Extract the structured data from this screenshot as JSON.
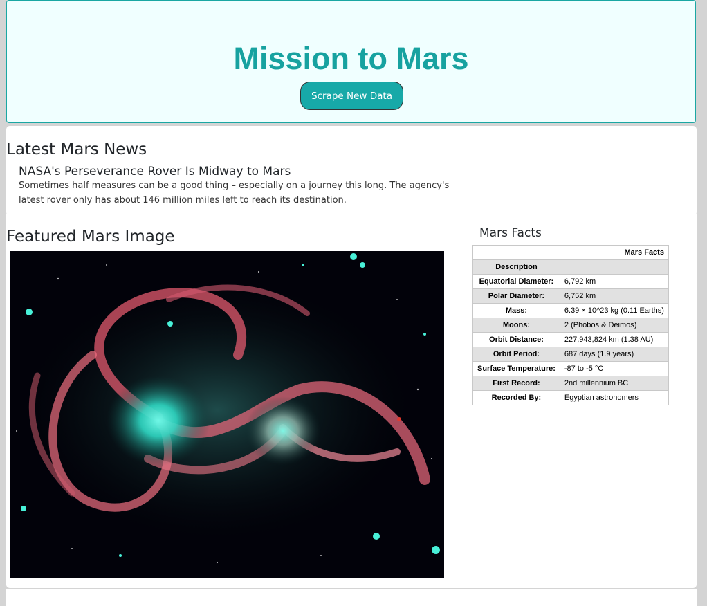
{
  "header": {
    "title": "Mission to Mars",
    "scrape_label": "Scrape New Data"
  },
  "news": {
    "heading": "Latest Mars News",
    "title": "NASA's Perseverance Rover Is Midway to Mars",
    "teaser": "Sometimes half measures can be a good thing – especially on a journey this long. The agency's latest rover only has about 146 million miles left to reach its destination."
  },
  "featured": {
    "heading": "Featured Mars Image"
  },
  "facts": {
    "heading": "Mars Facts",
    "header_row": {
      "label": "",
      "value": "Mars Facts"
    },
    "rows": [
      {
        "label": "Description",
        "value": ""
      },
      {
        "label": "Equatorial Diameter:",
        "value": "6,792 km"
      },
      {
        "label": "Polar Diameter:",
        "value": "6,752 km"
      },
      {
        "label": "Mass:",
        "value": "6.39 × 10^23 kg (0.11 Earths)"
      },
      {
        "label": "Moons:",
        "value": "2 (Phobos & Deimos)"
      },
      {
        "label": "Orbit Distance:",
        "value": "227,943,824 km (1.38 AU)"
      },
      {
        "label": "Orbit Period:",
        "value": "687 days (1.9 years)"
      },
      {
        "label": "Surface Temperature:",
        "value": "-87 to -5 °C"
      },
      {
        "label": "First Record:",
        "value": "2nd millennium BC"
      },
      {
        "label": "Recorded By:",
        "value": "Egyptian astronomers"
      }
    ]
  },
  "colors": {
    "accent": "#17a2a0",
    "button": "#17a9a8",
    "jumbotron_bg": "#f0ffff"
  }
}
